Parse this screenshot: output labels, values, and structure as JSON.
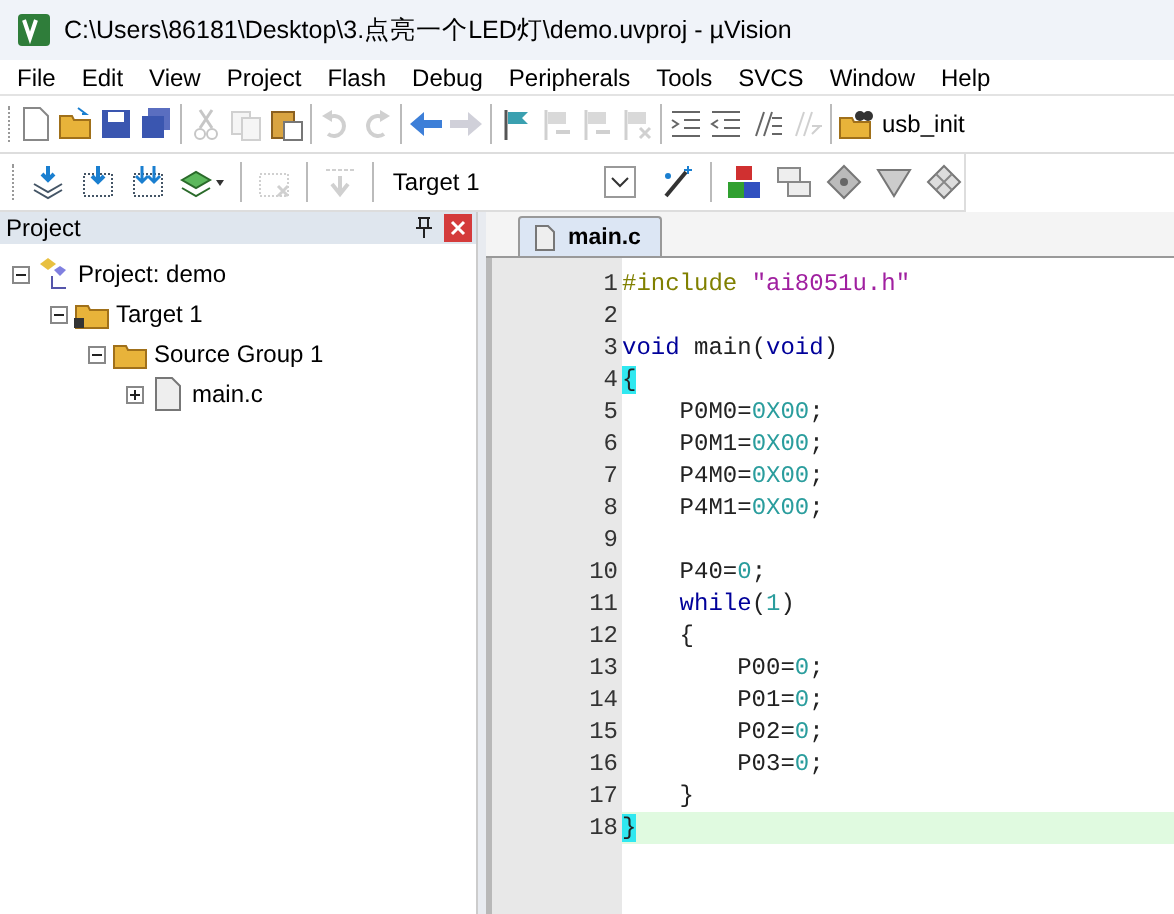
{
  "window": {
    "title": "C:\\Users\\86181\\Desktop\\3.点亮一个LED灯\\demo.uvproj - µVision"
  },
  "menu": [
    {
      "label": "File"
    },
    {
      "label": "Edit"
    },
    {
      "label": "View"
    },
    {
      "label": "Project"
    },
    {
      "label": "Flash"
    },
    {
      "label": "Debug"
    },
    {
      "label": "Peripherals"
    },
    {
      "label": "Tools"
    },
    {
      "label": "SVCS"
    },
    {
      "label": "Window"
    },
    {
      "label": "Help"
    }
  ],
  "toolbar_1": {
    "buttons": [
      {
        "disabled": false
      },
      {
        "disabled": false
      },
      {
        "disabled": false
      },
      {
        "disabled": false
      },
      {
        "disabled": true
      },
      {
        "disabled": true
      },
      {
        "disabled": false
      },
      {
        "disabled": true
      },
      {
        "disabled": true
      },
      {
        "disabled": false
      },
      {
        "disabled": true
      },
      {
        "disabled": false
      },
      {
        "disabled": true
      },
      {
        "disabled": true
      },
      {
        "disabled": true
      },
      {
        "disabled": false
      },
      {
        "disabled": false
      },
      {
        "disabled": false
      },
      {
        "disabled": true
      }
    ],
    "find_text": "usb_init"
  },
  "toolbar_2": {
    "buttons": [
      {
        "disabled": false
      },
      {
        "disabled": false
      },
      {
        "disabled": false
      },
      {
        "disabled": false
      },
      {
        "disabled": true
      },
      {
        "disabled": true
      }
    ],
    "target": "Target 1",
    "buttons_after": [
      {
        "disabled": false
      },
      {
        "disabled": false
      },
      {
        "disabled": false
      },
      {
        "disabled": false
      },
      {
        "disabled": false
      },
      {
        "disabled": false
      }
    ]
  },
  "project_panel": {
    "title": "Project",
    "tree": [
      {
        "label": "Project: demo",
        "kind": "project",
        "expanded": true,
        "children": [
          {
            "label": "Target 1",
            "kind": "target",
            "expanded": true,
            "children": [
              {
                "label": "Source Group 1",
                "kind": "group",
                "expanded": true,
                "children": [
                  {
                    "label": "main.c",
                    "kind": "file",
                    "expanded": false
                  }
                ]
              }
            ]
          }
        ]
      }
    ]
  },
  "editor": {
    "tabs": [
      {
        "label": "main.c",
        "selected": true
      }
    ],
    "lines": [
      {
        "number": "1",
        "current": false,
        "tokens": [
          {
            "kind": "preproc",
            "text": "#include "
          },
          {
            "kind": "string",
            "text": "\"ai8051u.h\""
          }
        ]
      },
      {
        "number": "2",
        "current": false
      },
      {
        "number": "3",
        "current": false,
        "tokens": [
          {
            "kind": "keyword",
            "text": "void"
          },
          {
            "kind": "plain",
            "text": " main("
          },
          {
            "kind": "keyword",
            "text": "void"
          },
          {
            "kind": "plain",
            "text": ")"
          }
        ]
      },
      {
        "number": "4",
        "current": false,
        "tokens": [
          {
            "kind": "match",
            "text": "{"
          }
        ]
      },
      {
        "number": "5",
        "current": false,
        "tokens": [
          {
            "kind": "plain",
            "text": "    P0M0="
          },
          {
            "kind": "number",
            "text": "0X00"
          },
          {
            "kind": "plain",
            "text": ";"
          }
        ]
      },
      {
        "number": "6",
        "current": false,
        "tokens": [
          {
            "kind": "plain",
            "text": "    P0M1="
          },
          {
            "kind": "number",
            "text": "0X00"
          },
          {
            "kind": "plain",
            "text": ";"
          }
        ]
      },
      {
        "number": "7",
        "current": false,
        "tokens": [
          {
            "kind": "plain",
            "text": "    P4M0="
          },
          {
            "kind": "number",
            "text": "0X00"
          },
          {
            "kind": "plain",
            "text": ";"
          }
        ]
      },
      {
        "number": "8",
        "current": false,
        "tokens": [
          {
            "kind": "plain",
            "text": "    P4M1="
          },
          {
            "kind": "number",
            "text": "0X00"
          },
          {
            "kind": "plain",
            "text": ";"
          }
        ]
      },
      {
        "number": "9",
        "current": false
      },
      {
        "number": "10",
        "current": false,
        "tokens": [
          {
            "kind": "plain",
            "text": "    P40="
          },
          {
            "kind": "number",
            "text": "0"
          },
          {
            "kind": "plain",
            "text": ";"
          }
        ]
      },
      {
        "number": "11",
        "current": false,
        "tokens": [
          {
            "kind": "keyword",
            "text": "    while"
          },
          {
            "kind": "plain",
            "text": "("
          },
          {
            "kind": "number",
            "text": "1"
          },
          {
            "kind": "plain",
            "text": ")"
          }
        ]
      },
      {
        "number": "12",
        "current": false,
        "tokens": [
          {
            "kind": "plain",
            "text": "    {"
          }
        ]
      },
      {
        "number": "13",
        "current": false,
        "tokens": [
          {
            "kind": "plain",
            "text": "        P00="
          },
          {
            "kind": "number",
            "text": "0"
          },
          {
            "kind": "plain",
            "text": ";"
          }
        ]
      },
      {
        "number": "14",
        "current": false,
        "tokens": [
          {
            "kind": "plain",
            "text": "        P01="
          },
          {
            "kind": "number",
            "text": "0"
          },
          {
            "kind": "plain",
            "text": ";"
          }
        ]
      },
      {
        "number": "15",
        "current": false,
        "tokens": [
          {
            "kind": "plain",
            "text": "        P02="
          },
          {
            "kind": "number",
            "text": "0"
          },
          {
            "kind": "plain",
            "text": ";"
          }
        ]
      },
      {
        "number": "16",
        "current": false,
        "tokens": [
          {
            "kind": "plain",
            "text": "        P03="
          },
          {
            "kind": "number",
            "text": "0"
          },
          {
            "kind": "plain",
            "text": ";"
          }
        ]
      },
      {
        "number": "17",
        "current": false,
        "tokens": [
          {
            "kind": "plain",
            "text": "    }"
          }
        ]
      },
      {
        "number": "18",
        "current": true,
        "tokens": [
          {
            "kind": "match",
            "text": "}"
          }
        ]
      }
    ]
  }
}
